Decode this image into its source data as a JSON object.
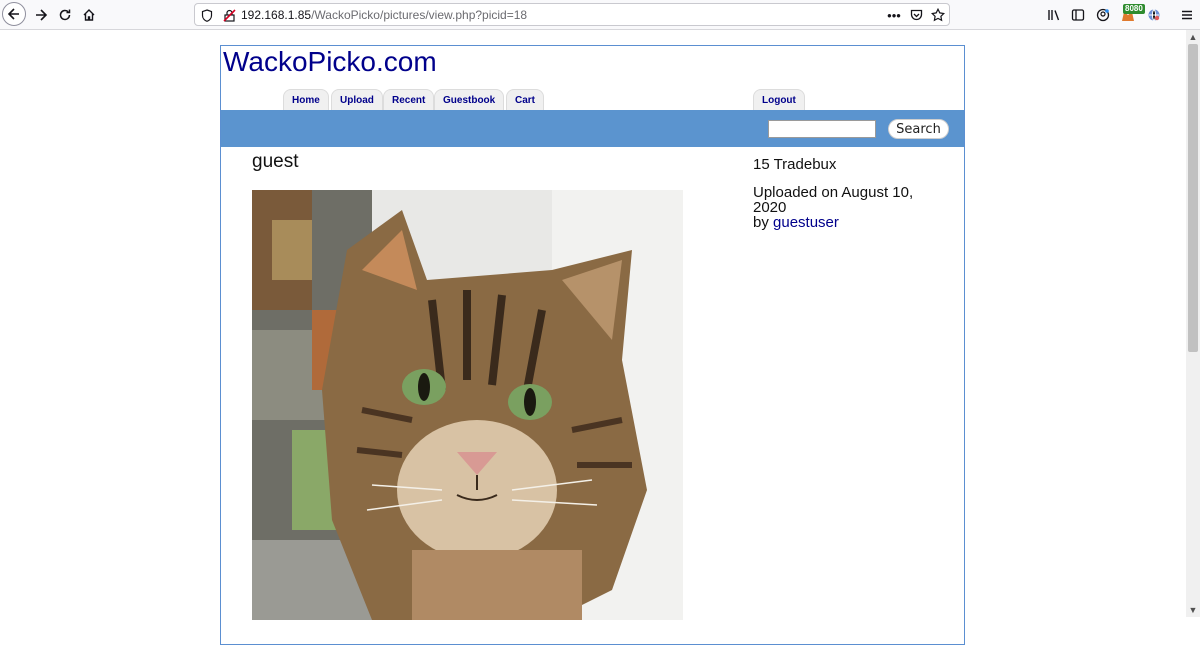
{
  "browser": {
    "url_host": "192.168.1.85",
    "url_path": "/WackoPicko/pictures/view.php?picid=18",
    "ext_badge": "8080"
  },
  "site": {
    "title": "WackoPicko.com",
    "nav": {
      "home": "Home",
      "upload": "Upload",
      "recent": "Recent",
      "guestbook": "Guestbook",
      "cart": "Cart",
      "logout": "Logout"
    },
    "search": {
      "placeholder": "",
      "button": "Search"
    }
  },
  "picture": {
    "title": "guest",
    "price": "15 Tradebux",
    "uploaded_prefix": "Uploaded on August 10, 2020",
    "by_prefix": "by",
    "uploader": "guestuser"
  },
  "colors": {
    "accent_bar": "#5b94cf",
    "link": "#00008b"
  }
}
